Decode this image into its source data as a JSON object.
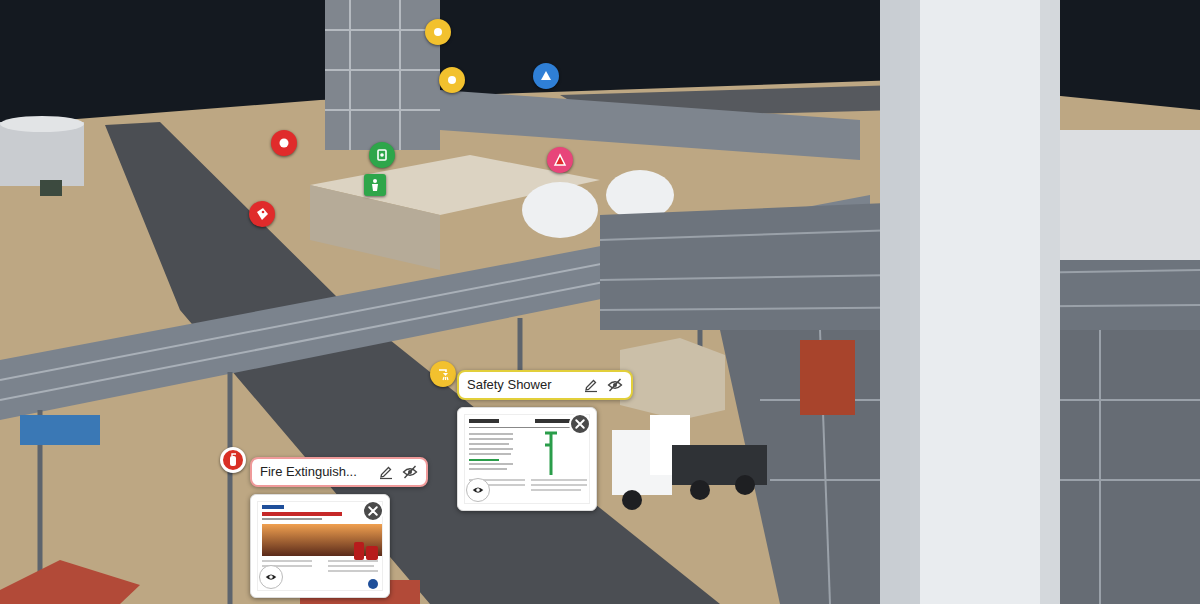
{
  "pins": [
    {
      "color": "#f2c12e",
      "kind": "round"
    },
    {
      "color": "#f2c12e",
      "kind": "round"
    },
    {
      "color": "#2f7fd6",
      "kind": "round"
    },
    {
      "color": "#e02b2b",
      "kind": "round"
    },
    {
      "color": "#2ea64a",
      "kind": "round"
    },
    {
      "color": "#2ea64a",
      "kind": "square"
    },
    {
      "color": "#e02b2b",
      "kind": "round"
    },
    {
      "color": "#e8457a",
      "kind": "round"
    },
    {
      "color": "#f2c12e",
      "kind": "round"
    },
    {
      "color": "#d93025",
      "kind": "round"
    }
  ],
  "annotations": [
    {
      "title": "Safety Shower",
      "color": "#e2cf3a",
      "kind": "datasheet"
    },
    {
      "title": "Fire Extinguish...",
      "color": "#ef9a9a",
      "kind": "brochure"
    }
  ]
}
